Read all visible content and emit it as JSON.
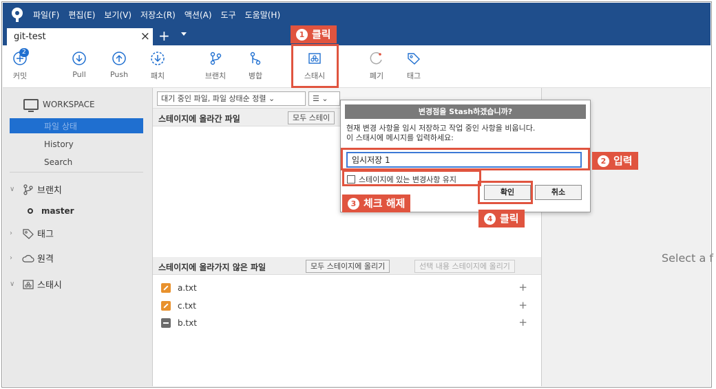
{
  "menu": [
    "파일(F)",
    "편집(E)",
    "보기(V)",
    "저장소(R)",
    "액션(A)",
    "도구",
    "도움말(H)"
  ],
  "tab": {
    "title": "git-test",
    "close": "×",
    "add": "+"
  },
  "toolbar": {
    "commit": {
      "label": "커밋",
      "badge": "2"
    },
    "pull": "Pull",
    "push": "Push",
    "fetch": "패치",
    "branch": "브랜치",
    "merge": "병합",
    "stash": "스태시",
    "discard": "폐기",
    "tag": "태그"
  },
  "sidebar": {
    "workspace": "WORKSPACE",
    "file_status": "파일 상태",
    "history": "History",
    "search": "Search",
    "branches": "브랜치",
    "master": "master",
    "tags": "태그",
    "remotes": "원격",
    "stashes": "스태시"
  },
  "main": {
    "filter": "대기 중인 파일, 파일 상태순 정렬 ⌄",
    "list_toggle": "☰ ⌄",
    "staged_header": "스테이지에 올라간 파일",
    "unstage_all": "모두 스테이",
    "unstaged_header": "스테이지에 올라가지 않은 파일",
    "stage_all": "모두 스테이지에 올리기",
    "stage_selected": "선택 내용 스테이지에 올리기",
    "files": [
      {
        "name": "a.txt",
        "status": "modified"
      },
      {
        "name": "c.txt",
        "status": "modified"
      },
      {
        "name": "b.txt",
        "status": "removed"
      }
    ],
    "plus": "+"
  },
  "right_panel": {
    "hint": "Select a f"
  },
  "dialog": {
    "title": "변경점을 Stash하겠습니까?",
    "message_line1": "현재 변경 사항을 임시 저장하고 작업 중인 사항을 비웁니다.",
    "message_line2": "이 스태시에 메시지를 입력하세요:",
    "input_value": "임시저장 1",
    "keep_staged": "스테이지에 있는 변경사항 유지",
    "ok": "확인",
    "cancel": "취소"
  },
  "annotations": {
    "step1": {
      "num": "1",
      "text": "클릭"
    },
    "step2": {
      "num": "2",
      "text": "입력"
    },
    "step3": {
      "num": "3",
      "text": "체크 해제"
    },
    "step4": {
      "num": "4",
      "text": "클릭"
    }
  },
  "colors": {
    "titlebar": "#1f4e8c",
    "selection": "#1f6fd0",
    "annotation": "#e0543f",
    "modified": "#e8912d"
  }
}
